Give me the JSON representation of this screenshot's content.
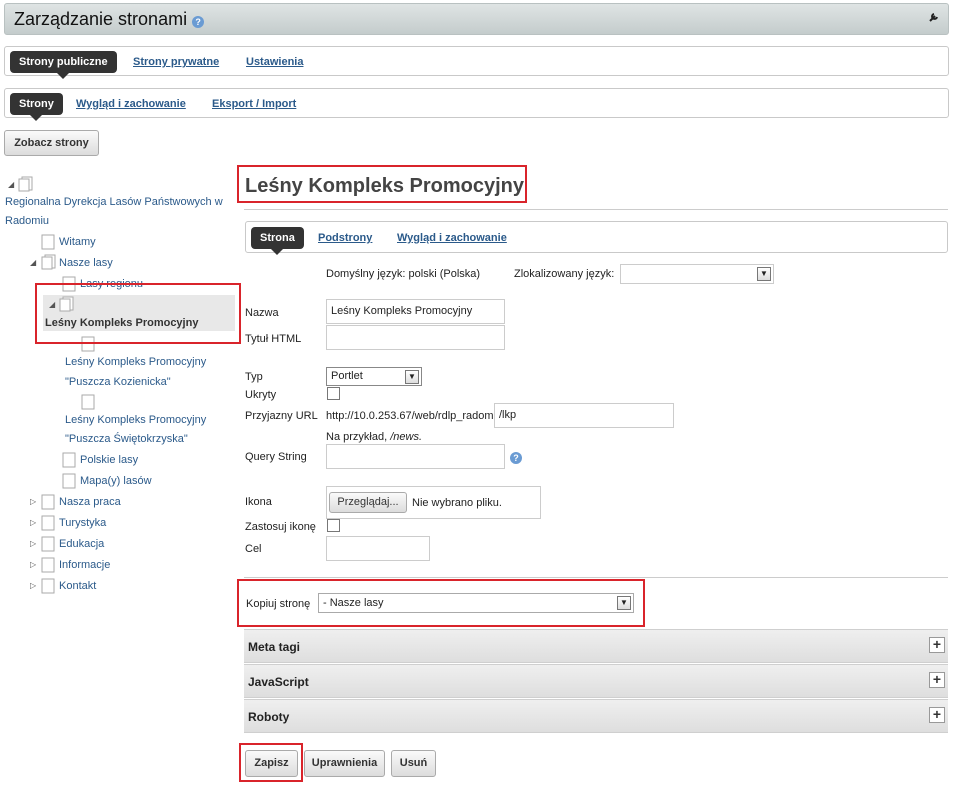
{
  "header": {
    "title": "Zarządzanie stronami",
    "help_icon": "?",
    "tool_icon": "wrench"
  },
  "tabs1": {
    "active": "Strony publiczne",
    "items": [
      "Strony prywatne",
      "Ustawienia"
    ]
  },
  "tabs2": {
    "active": "Strony",
    "items": [
      "Wygląd i zachowanie",
      "Eksport / Import"
    ]
  },
  "view_pages_button": "Zobacz strony",
  "tree": {
    "root_line1": "Regionalna Dyrekcja Lasów Państwowych w",
    "root_line2": "Radomiu",
    "items": {
      "witamy": "Witamy",
      "nasze_lasy": "Nasze lasy",
      "lasy_regionu": "Lasy regionu",
      "lesny_kompleks": "Leśny Kompleks Promocyjny",
      "kozienicka_1": "Leśny Kompleks Promocyjny",
      "kozienicka_2": "\"Puszcza Kozienicka\"",
      "swietokrzyska_1": "Leśny Kompleks Promocyjny",
      "swietokrzyska_2": "\"Puszcza Świętokrzyska\"",
      "polskie_lasy": "Polskie lasy",
      "mapa_lasow": "Mapa(y) lasów",
      "nasza_praca": "Nasza praca",
      "turystyka": "Turystyka",
      "edukacja": "Edukacja",
      "informacje": "Informacje",
      "kontakt": "Kontakt"
    }
  },
  "page_title": "Leśny Kompleks Promocyjny",
  "tabs3": {
    "active": "Strona",
    "items": [
      "Podstrony",
      "Wygląd i zachowanie"
    ]
  },
  "form": {
    "default_language": "Domyślny język: polski (Polska)",
    "localized_language_label": "Zlokalizowany język:",
    "localized_language_value": "",
    "name_label": "Nazwa",
    "name_value": "Leśny Kompleks Promocyjny",
    "html_title_label": "Tytuł HTML",
    "html_title_value": "",
    "type_label": "Typ",
    "type_value": "Portlet",
    "hidden_label": "Ukryty",
    "friendly_url_label": "Przyjazny URL",
    "friendly_url_prefix": "http://10.0.253.67/web/rdlp_radom",
    "friendly_url_value": "/lkp",
    "example_prefix": "Na przykład, ",
    "example_value": "/news.",
    "query_string_label": "Query String",
    "query_string_value": "",
    "icon_label": "Ikona",
    "browse_button": "Przeglądaj...",
    "no_file": "Nie wybrano pliku.",
    "apply_icon_label": "Zastosuj ikonę",
    "target_label": "Cel",
    "target_value": "",
    "copy_page_label": "Kopiuj stronę",
    "copy_page_value": "- Nasze lasy"
  },
  "panels": [
    "Meta tagi",
    "JavaScript",
    "Roboty"
  ],
  "buttons": {
    "save": "Zapisz",
    "permissions": "Uprawnienia",
    "delete": "Usuń"
  },
  "colors": {
    "highlight": "#d9242b",
    "link": "#2b5a8a",
    "pill": "#333333"
  }
}
